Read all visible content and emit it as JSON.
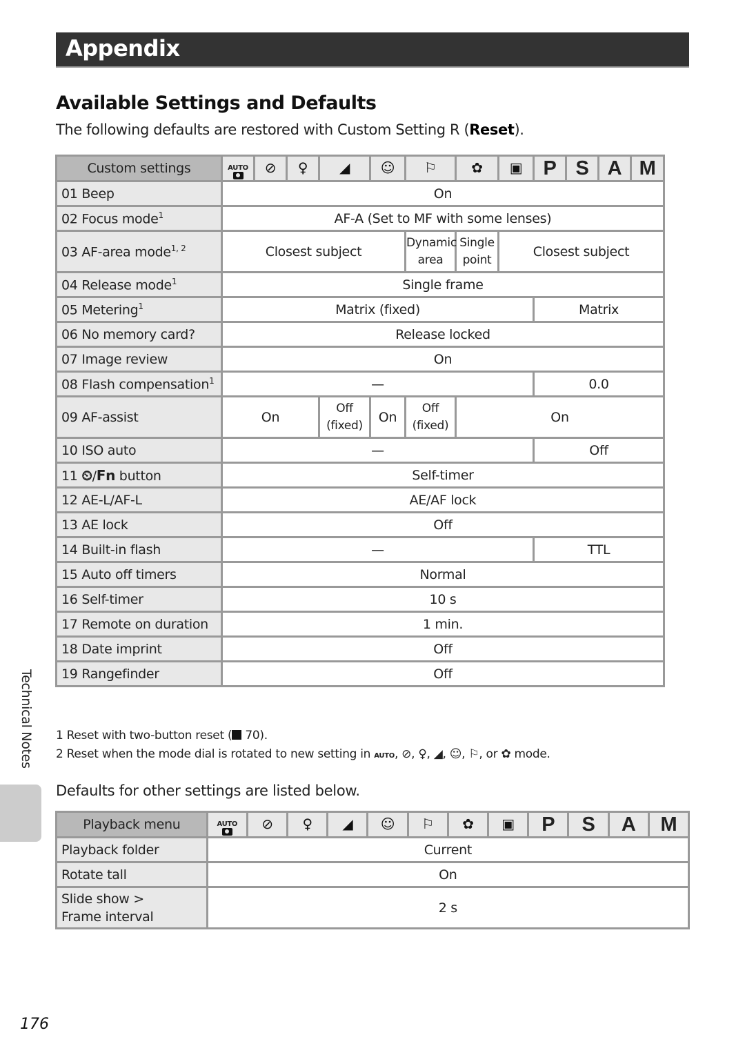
{
  "banner": {
    "title": "Appendix"
  },
  "section": {
    "title": "Available Settings and Defaults",
    "intro_before": "The following defaults are restored with Custom Setting R (",
    "intro_bold": "Reset",
    "intro_after": ")."
  },
  "modes": {
    "icons": [
      "auto-icon",
      "flash-off-icon",
      "portrait-icon",
      "landscape-icon",
      "child-icon",
      "sports-icon",
      "close-up-icon",
      "night-portrait-icon"
    ],
    "glyphs": {
      "auto": "AUTO",
      "flash_off": "⚡",
      "portrait": "♀",
      "landscape": "◢",
      "child": "☺",
      "sports": "🏃",
      "close_up": "✿",
      "night_portrait": "★"
    },
    "letters": [
      "P",
      "S",
      "A",
      "M"
    ]
  },
  "custom_table": {
    "header": "Custom settings",
    "rows": [
      {
        "label": "01 Beep",
        "values": [
          "On"
        ]
      },
      {
        "label": "02 Focus mode",
        "sup": "1",
        "values": [
          "AF-A (Set to MF with some lenses)"
        ]
      },
      {
        "label": "03 AF-area mode",
        "sup": "1, 2",
        "values": [
          "Closest subject",
          "Dynamic area",
          "Single point",
          "Closest subject"
        ]
      },
      {
        "label": "04 Release mode",
        "sup": "1",
        "values": [
          "Single frame"
        ]
      },
      {
        "label": "05 Metering",
        "sup": "1",
        "values": [
          "Matrix (fixed)",
          "Matrix"
        ]
      },
      {
        "label": "06 No memory card?",
        "values": [
          "Release locked"
        ]
      },
      {
        "label": "07 Image review",
        "values": [
          "On"
        ]
      },
      {
        "label": "08 Flash compensation",
        "sup": "1",
        "values": [
          "—",
          "0.0"
        ]
      },
      {
        "label": "09 AF-assist",
        "values": [
          "On",
          "Off (fixed)",
          "On",
          "Off (fixed)",
          "On"
        ]
      },
      {
        "label": "10 ISO auto",
        "values": [
          "—",
          "Off"
        ]
      },
      {
        "label_prefix": "11 ",
        "label_fn": "Fn",
        "label_suffix": " button",
        "values": [
          "Self-timer"
        ]
      },
      {
        "label": "12 AE-L/AF-L",
        "values": [
          "AE/AF lock"
        ]
      },
      {
        "label": "13 AE lock",
        "values": [
          "Off"
        ]
      },
      {
        "label": "14 Built-in flash",
        "values": [
          "—",
          "TTL"
        ]
      },
      {
        "label": "15 Auto off timers",
        "values": [
          "Normal"
        ]
      },
      {
        "label": "16 Self-timer",
        "values": [
          "10 s"
        ]
      },
      {
        "label": "17 Remote on duration",
        "values": [
          "1 min."
        ]
      },
      {
        "label": "18 Date imprint",
        "values": [
          "Off"
        ]
      },
      {
        "label": "19 Rangefinder",
        "values": [
          "Off"
        ]
      }
    ]
  },
  "footnotes": {
    "n1": "1 Reset with two-button reset (",
    "n1_ref": "70).",
    "n2_before": "2 Reset when the mode dial is rotated to new setting in",
    "n2_or": ", or",
    "n2_after": "mode."
  },
  "other_intro": "Defaults for other settings are listed below.",
  "playback_table": {
    "header": "Playback menu",
    "rows": [
      {
        "label": "Playback folder",
        "value": "Current"
      },
      {
        "label": "Rotate tall",
        "value": "On"
      },
      {
        "label_line1": "Slide show >",
        "label_line2": "Frame interval",
        "value": "2 s"
      }
    ]
  },
  "side_tab": {
    "label": "Technical Notes"
  },
  "page_number": "176"
}
